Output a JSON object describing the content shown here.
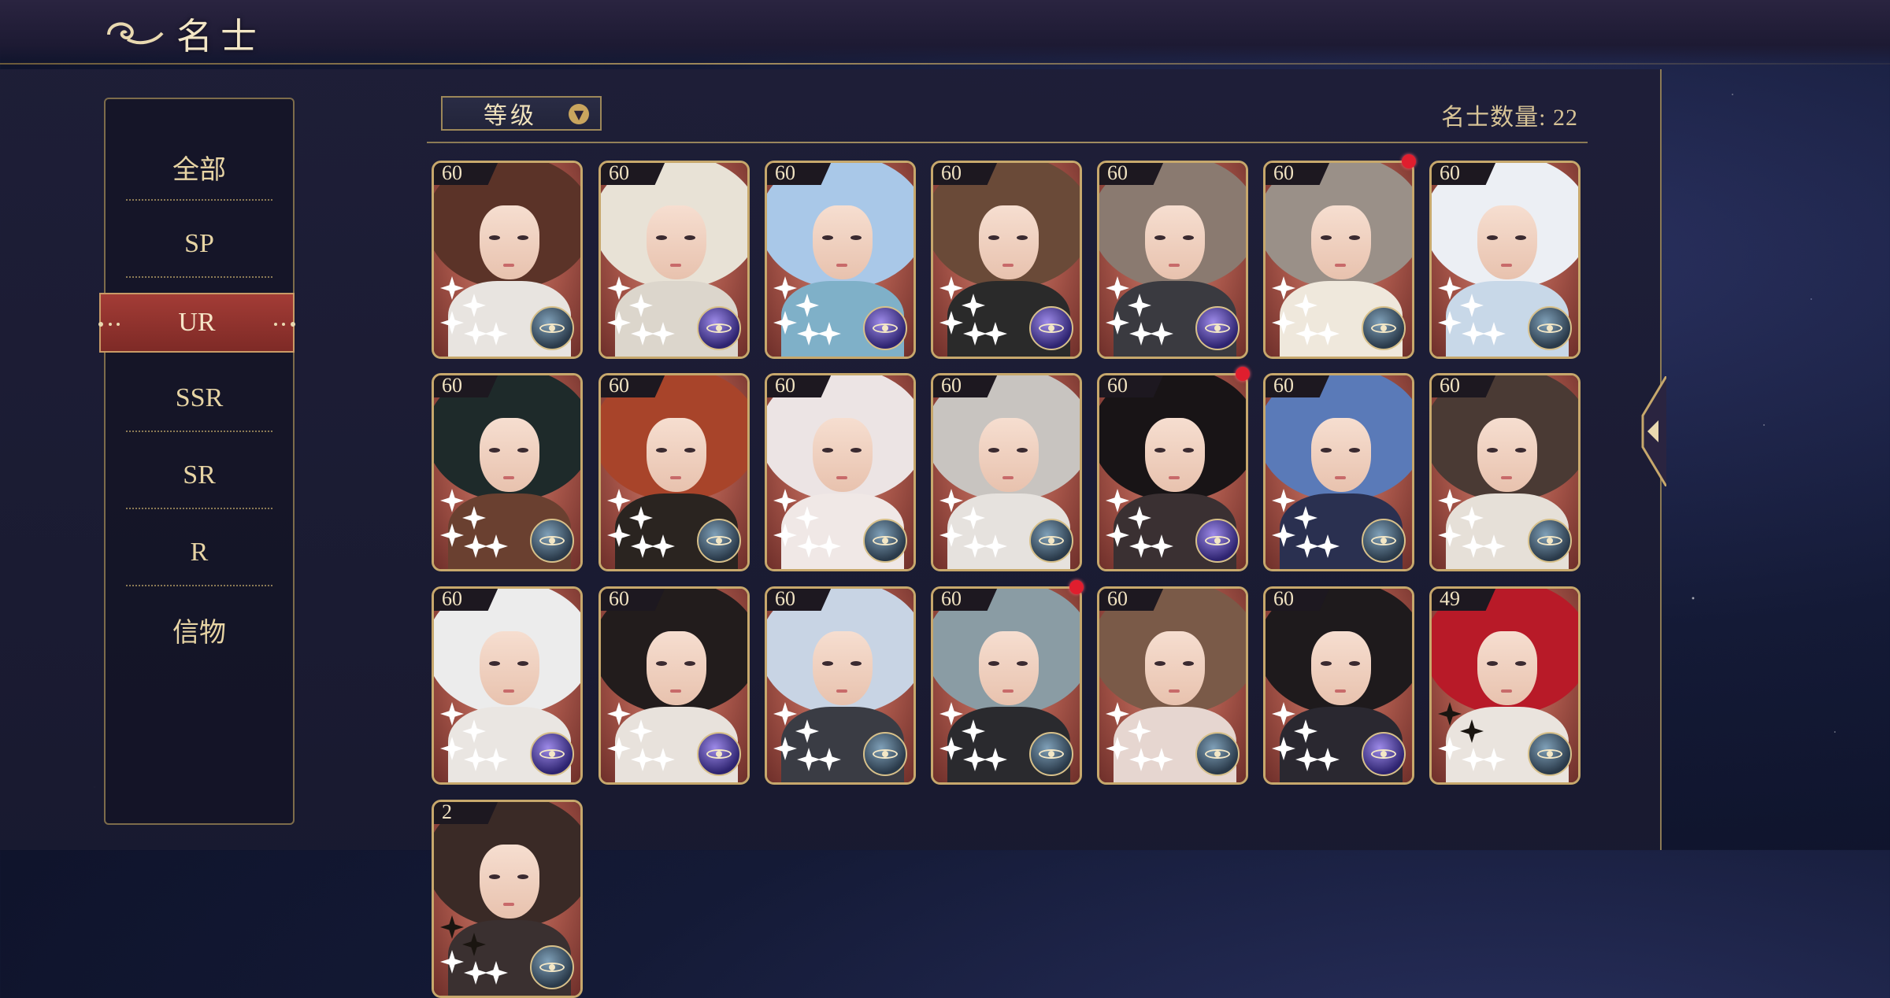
{
  "header": {
    "title": "名士"
  },
  "sidebar": {
    "items": [
      {
        "label": "全部"
      },
      {
        "label": "SP"
      },
      {
        "label": "UR"
      },
      {
        "label": "SSR"
      },
      {
        "label": "SR"
      },
      {
        "label": "R"
      },
      {
        "label": "信物"
      }
    ],
    "selected": "UR"
  },
  "toolbar": {
    "sort_label": "等级",
    "sort_icon": "chevron-down-icon",
    "count_label": "名士数量: 22"
  },
  "colors": {
    "panel": "#1e1e37",
    "gold_border": "#c7a86c",
    "active_tab": "#a33c36",
    "notification": "#e01e2e"
  },
  "cards": [
    {
      "level": "60",
      "emblem": "gray",
      "notify": false,
      "hair": "#5b3328",
      "body": "#e8e4e0"
    },
    {
      "level": "60",
      "emblem": "purple",
      "notify": false,
      "hair": "#e8e2d6",
      "body": "#dcd6cc"
    },
    {
      "level": "60",
      "emblem": "purple",
      "notify": false,
      "hair": "#a9c8e8",
      "body": "#7fb0c8"
    },
    {
      "level": "60",
      "emblem": "purple",
      "notify": false,
      "hair": "#6a4a38",
      "body": "#2a2a2a"
    },
    {
      "level": "60",
      "emblem": "purple",
      "notify": false,
      "hair": "#8a7a70",
      "body": "#3a3a40"
    },
    {
      "level": "60",
      "emblem": "gray",
      "notify": true,
      "hair": "#9a9088",
      "body": "#efe8dc"
    },
    {
      "level": "60",
      "emblem": "gray",
      "notify": false,
      "hair": "#eceff4",
      "body": "#c8d8e8"
    },
    {
      "level": "60",
      "emblem": "gray",
      "notify": false,
      "hair": "#1e2a2a",
      "body": "#6a4030"
    },
    {
      "level": "60",
      "emblem": "gray",
      "notify": false,
      "hair": "#a8442a",
      "body": "#2a2420"
    },
    {
      "level": "60",
      "emblem": "gray",
      "notify": false,
      "hair": "#ece4e4",
      "body": "#f0e8e6"
    },
    {
      "level": "60",
      "emblem": "gray",
      "notify": false,
      "hair": "#c8c4c0",
      "body": "#e6e2de"
    },
    {
      "level": "60",
      "emblem": "purple",
      "notify": true,
      "hair": "#181416",
      "body": "#3a3032"
    },
    {
      "level": "60",
      "emblem": "gray",
      "notify": false,
      "hair": "#5a7ab8",
      "body": "#2a3050"
    },
    {
      "level": "60",
      "emblem": "gray",
      "notify": false,
      "hair": "#4a3a34",
      "body": "#e6e0d8"
    },
    {
      "level": "60",
      "emblem": "purple",
      "notify": false,
      "hair": "#ececec",
      "body": "#eae6e2"
    },
    {
      "level": "60",
      "emblem": "purple",
      "notify": false,
      "hair": "#221c1c",
      "body": "#e8e2dc"
    },
    {
      "level": "60",
      "emblem": "gray",
      "notify": false,
      "hair": "#c8d4e4",
      "body": "#3a3c44"
    },
    {
      "level": "60",
      "emblem": "gray",
      "notify": true,
      "hair": "#8a9ca4",
      "body": "#2a2a2e"
    },
    {
      "level": "60",
      "emblem": "gray",
      "notify": false,
      "hair": "#7a5a48",
      "body": "#e6d6d0"
    },
    {
      "level": "60",
      "emblem": "purple",
      "notify": false,
      "hair": "#1e1a1c",
      "body": "#2a2830"
    },
    {
      "level": "49",
      "emblem": "gray",
      "notify": false,
      "hair": "#b81a28",
      "body": "#eae4de"
    },
    {
      "level": "2",
      "emblem": "gray",
      "notify": false,
      "hair": "#3a2a26",
      "body": "#3a3030"
    }
  ]
}
